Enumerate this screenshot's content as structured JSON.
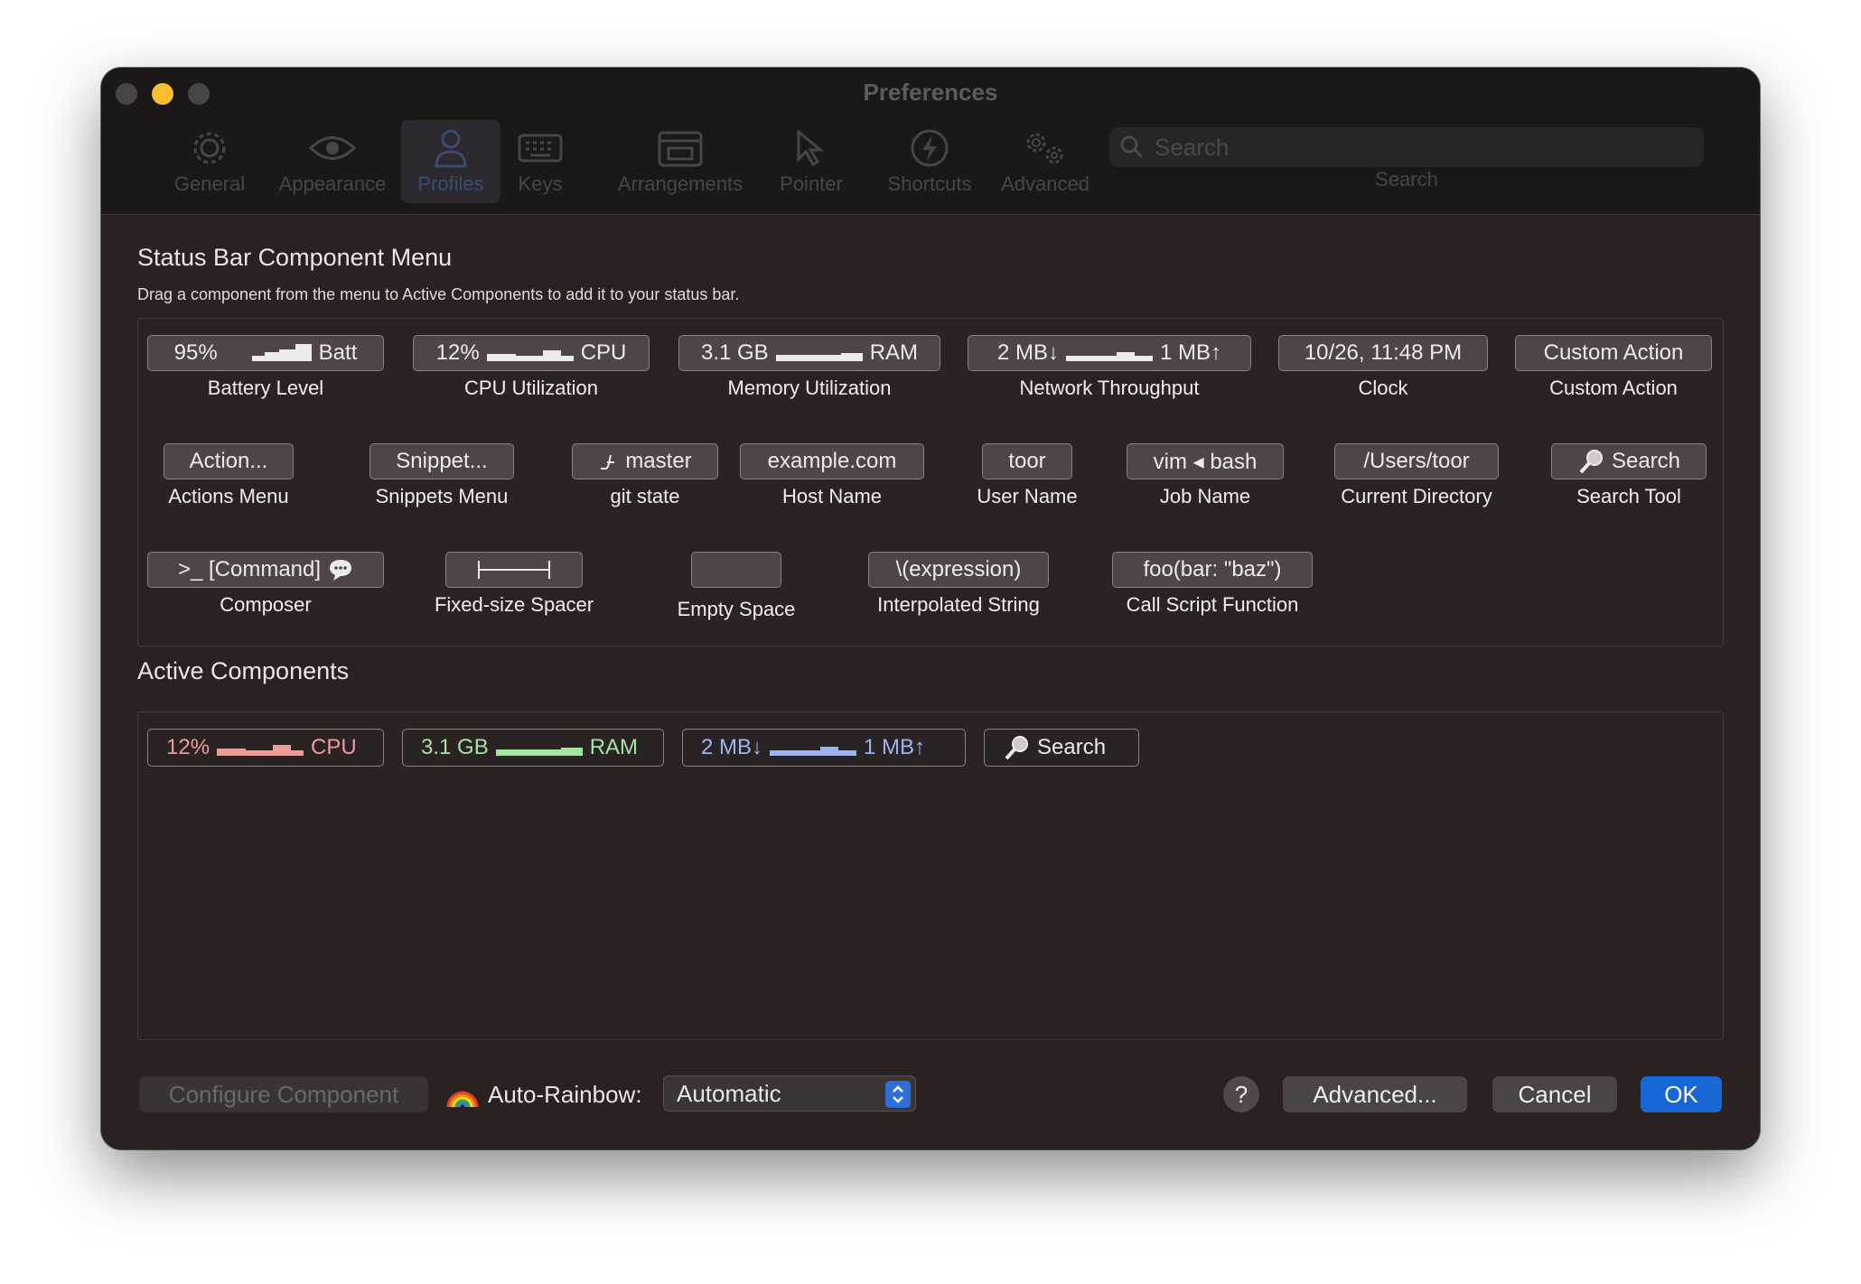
{
  "window": {
    "title": "Preferences"
  },
  "toolbar": {
    "items": [
      {
        "label": "General",
        "icon": "gear-icon"
      },
      {
        "label": "Appearance",
        "icon": "eye-icon"
      },
      {
        "label": "Profiles",
        "icon": "person-icon"
      },
      {
        "label": "Keys",
        "icon": "keyboard-icon"
      },
      {
        "label": "Arrangements",
        "icon": "window-icon"
      },
      {
        "label": "Pointer",
        "icon": "pointer-icon"
      },
      {
        "label": "Shortcuts",
        "icon": "lightning-icon"
      },
      {
        "label": "Advanced",
        "icon": "gears-icon"
      }
    ],
    "selected": "Profiles",
    "search": {
      "placeholder": "Search",
      "caption": "Search"
    }
  },
  "menu": {
    "title": "Status Bar Component Menu",
    "subtitle": "Drag a component from the menu to Active Components to add it to your status bar.",
    "components": [
      {
        "chip_left": "95%",
        "chip_right": "Batt",
        "name": "Battery Level"
      },
      {
        "chip_left": "12%",
        "chip_right": "CPU",
        "name": "CPU Utilization"
      },
      {
        "chip_left": "3.1 GB",
        "chip_right": "RAM",
        "name": "Memory Utilization"
      },
      {
        "chip_left": "2 MB↓",
        "chip_right": "1 MB↑",
        "name": "Network Throughput"
      },
      {
        "chip": "10/26, 11:48 PM",
        "name": "Clock"
      },
      {
        "chip": "Custom Action",
        "name": "Custom Action"
      },
      {
        "chip": "Action...",
        "name": "Actions Menu"
      },
      {
        "chip": "Snippet...",
        "name": "Snippets Menu"
      },
      {
        "chip": "master",
        "name": "git state"
      },
      {
        "chip": "example.com",
        "name": "Host Name"
      },
      {
        "chip": "toor",
        "name": "User Name"
      },
      {
        "chip": "vim ◂ bash",
        "name": "Job Name"
      },
      {
        "chip": "/Users/toor",
        "name": "Current Directory"
      },
      {
        "chip": "Search",
        "name": "Search Tool"
      },
      {
        "chip": ">_ [Command]",
        "name": "Composer"
      },
      {
        "chip": "",
        "name": "Fixed-size Spacer"
      },
      {
        "chip": "",
        "name": "Empty Space"
      },
      {
        "chip": "\\(expression)",
        "name": "Interpolated String"
      },
      {
        "chip": "foo(bar: \"baz\")",
        "name": "Call Script Function"
      }
    ]
  },
  "active": {
    "title": "Active Components",
    "chips": [
      {
        "left": "12%",
        "right": "CPU",
        "color": "#f19a9a"
      },
      {
        "left": "3.1 GB",
        "right": "RAM",
        "color": "#a6e3a1"
      },
      {
        "left": "2 MB↓",
        "right": "1 MB↑",
        "color": "#9fb4ee"
      },
      {
        "label": "Search",
        "color": "#ecebeb"
      }
    ]
  },
  "footer": {
    "configure": "Configure Component",
    "auto_rainbow_label": "Auto-Rainbow:",
    "auto_rainbow_value": "Automatic",
    "help": "?",
    "advanced": "Advanced...",
    "cancel": "Cancel",
    "ok": "OK"
  }
}
